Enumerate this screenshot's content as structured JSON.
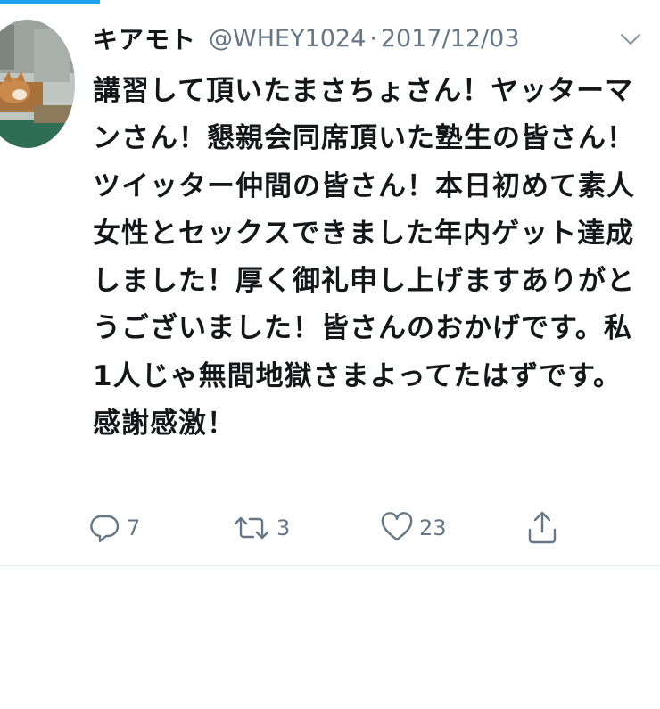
{
  "tweet": {
    "display_name": "キアモト",
    "handle": "@WHEY1024",
    "separator": "·",
    "date": "2017/12/03",
    "text": "講習して頂いたまさちょさん！ヤッターマンさん！懇親会同席頂いた塾生の皆さん！ツイッター仲間の皆さん！本日初めて素人女性とセックスできました年内ゲット達成しました！厚く御礼申し上げますありがとうございました！皆さんのおかげです。私1人じゃ無間地獄さまよってたはずです。感謝感激！",
    "actions": {
      "reply_count": "7",
      "retweet_count": "3",
      "like_count": "23"
    }
  },
  "icons": {
    "reply": "reply-icon",
    "retweet": "retweet-icon",
    "like": "heart-icon",
    "share": "share-icon",
    "more": "chevron-down-icon"
  },
  "colors": {
    "accent": "#1da1f2",
    "secondary_text": "#657786",
    "primary_text": "#14171a",
    "border": "#e6ecf0"
  }
}
